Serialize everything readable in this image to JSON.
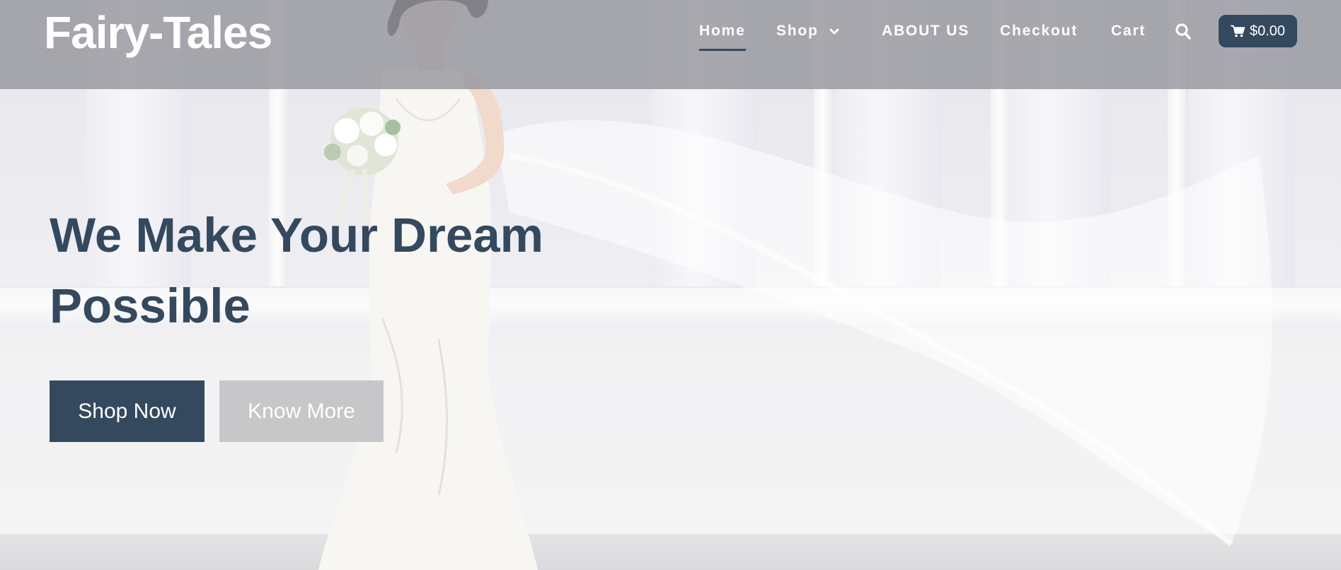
{
  "header": {
    "logo": "Fairy-Tales",
    "nav": [
      {
        "label": "Home",
        "active": true
      },
      {
        "label": "Shop",
        "has_dropdown": true,
        "dropdown_icon": "chevron-down-icon"
      },
      {
        "label": "ABOUT US"
      },
      {
        "label": "Checkout"
      },
      {
        "label": "Cart"
      }
    ],
    "search_icon": "search-icon",
    "cart_total": "$0.00",
    "cart_icon": "shopping-cart-icon"
  },
  "hero": {
    "title": "We Make Your Dream Possible",
    "buttons": {
      "shop_now": "Shop Now",
      "know_more": "Know More"
    }
  },
  "colors": {
    "accent": "#34495e",
    "header_overlay": "#96969e",
    "secondary_button": "#c7c7c9",
    "text_light": "#ffffff"
  }
}
